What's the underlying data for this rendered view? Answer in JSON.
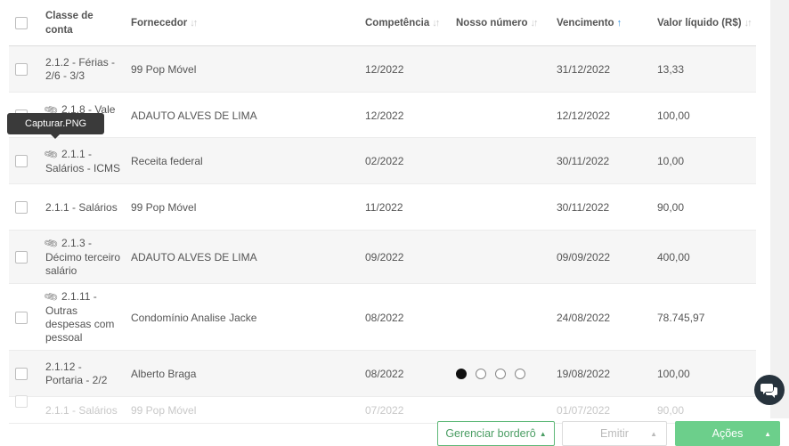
{
  "table": {
    "headers": {
      "classe": "Classe de conta",
      "fornecedor": "Fornecedor",
      "competencia": "Competência",
      "nosso_numero": "Nosso número",
      "vencimento": "Vencimento",
      "valor": "Valor líquido (R$)"
    },
    "rows": [
      {
        "classe": "2.1.2 - Férias - 2/6 - 3/3",
        "fornecedor": "99 Pop Móvel",
        "competencia": "12/2022",
        "vencimento": "31/12/2022",
        "valor": "13,33"
      },
      {
        "classe": "2.1.8 - Vale",
        "fornecedor": "ADAUTO ALVES DE LIMA",
        "competencia": "12/2022",
        "vencimento": "12/12/2022",
        "valor": "100,00"
      },
      {
        "classe": "2.1.1 - Salários - ICMS",
        "fornecedor": "Receita federal",
        "competencia": "02/2022",
        "vencimento": "30/11/2022",
        "valor": "10,00"
      },
      {
        "classe": "2.1.1 - Salários",
        "fornecedor": "99 Pop Móvel",
        "competencia": "11/2022",
        "vencimento": "30/11/2022",
        "valor": "90,00"
      },
      {
        "classe": "2.1.3 - Décimo terceiro salário",
        "fornecedor": "ADAUTO ALVES DE LIMA",
        "competencia": "09/2022",
        "vencimento": "09/09/2022",
        "valor": "400,00"
      },
      {
        "classe": "2.1.11 - Outras despesas com pessoal",
        "fornecedor": "Condomínio Analise Jacke",
        "competencia": "08/2022",
        "vencimento": "24/08/2022",
        "valor": "78.745,97"
      },
      {
        "classe": "2.1.12 - Portaria - 2/2",
        "fornecedor": "Alberto Braga",
        "competencia": "08/2022",
        "vencimento": "19/08/2022",
        "valor": "100,00"
      },
      {
        "classe": "2.1.1 - Salários",
        "fornecedor": "99 Pop Móvel",
        "competencia": "07/2022",
        "vencimento": "01/07/2022",
        "valor": "90,00"
      }
    ]
  },
  "tooltip": "Capturar.PNG",
  "buttons": {
    "bordero": "Gerenciar borderô",
    "emitir": "Emitir",
    "acoes": "Ações"
  },
  "icons": {
    "attachment": "paperclip-icon",
    "sort": "sort-arrows-icon",
    "sort_active": "arrow-up-icon",
    "chat": "chat-bubbles-icon"
  },
  "colors": {
    "accent_green": "#6ccf8b",
    "sort_active": "#2a8ee0",
    "chat_bg": "#27333d"
  }
}
